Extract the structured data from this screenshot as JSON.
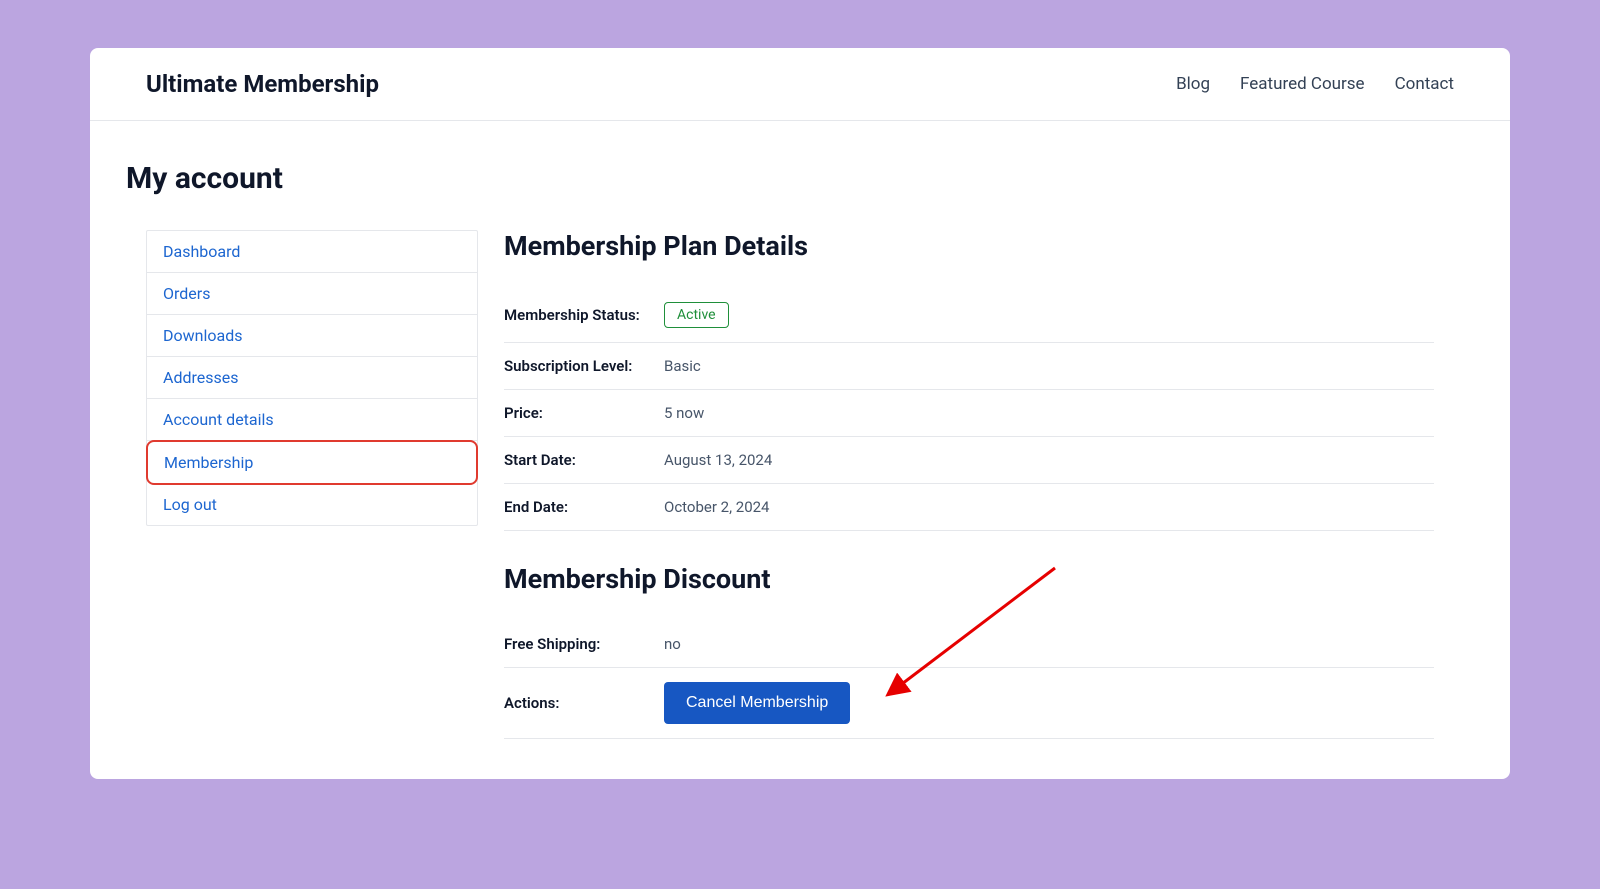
{
  "header": {
    "brand": "Ultimate Membership",
    "links": [
      "Blog",
      "Featured Course",
      "Contact"
    ]
  },
  "page": {
    "title": "My account"
  },
  "sidenav": {
    "items": [
      {
        "label": "Dashboard"
      },
      {
        "label": "Orders"
      },
      {
        "label": "Downloads"
      },
      {
        "label": "Addresses"
      },
      {
        "label": "Account details"
      },
      {
        "label": "Membership"
      },
      {
        "label": "Log out"
      }
    ],
    "active_index": 5
  },
  "details": {
    "title": "Membership Plan Details",
    "rows": {
      "status_label": "Membership Status:",
      "status_value": "Active",
      "level_label": "Subscription Level:",
      "level_value": "Basic",
      "price_label": "Price:",
      "price_value": "5 now",
      "start_label": "Start Date:",
      "start_value": "August 13, 2024",
      "end_label": "End Date:",
      "end_value": "October 2, 2024"
    }
  },
  "discount": {
    "title": "Membership Discount",
    "shipping_label": "Free Shipping:",
    "shipping_value": "no",
    "actions_label": "Actions:",
    "cancel_button": "Cancel Membership"
  }
}
